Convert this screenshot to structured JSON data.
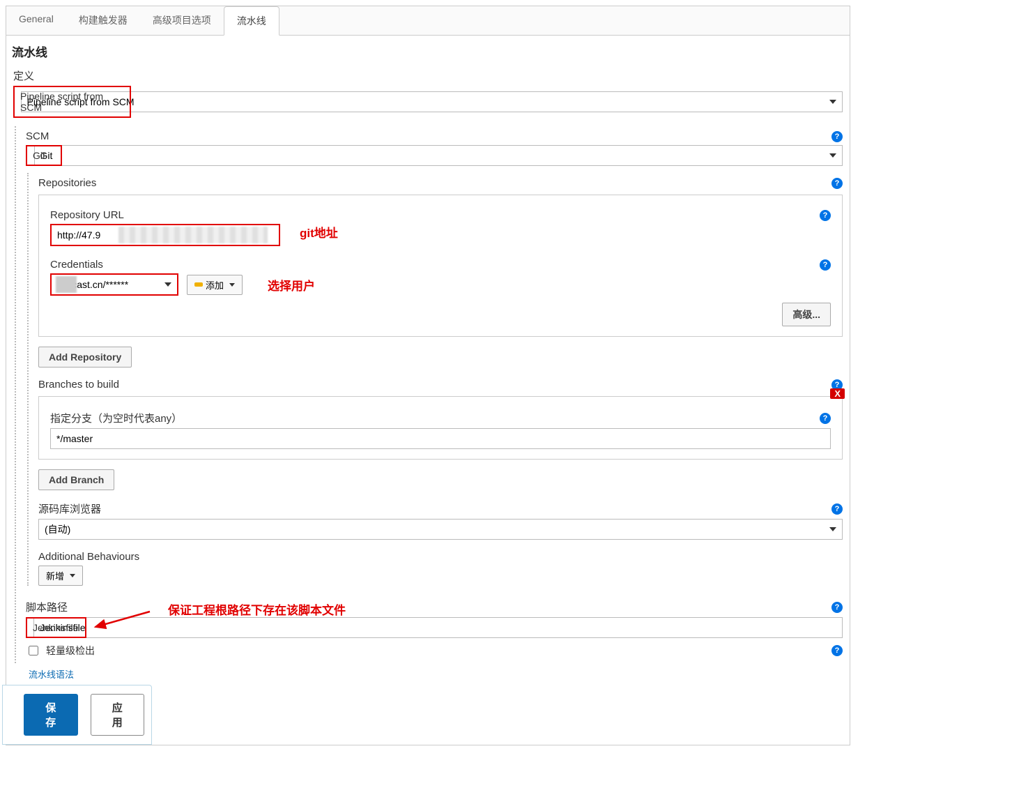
{
  "tabs": {
    "general": "General",
    "triggers": "构建触发器",
    "advanced": "高级项目选项",
    "pipeline": "流水线"
  },
  "sectionTitle": "流水线",
  "labels": {
    "definition": "定义",
    "scm": "SCM",
    "repositories": "Repositories",
    "repoUrl": "Repository URL",
    "credentials": "Credentials",
    "branches": "Branches to build",
    "branchSpec": "指定分支（为空时代表any）",
    "repoBrowser": "源码库浏览器",
    "additionalBehaviours": "Additional Behaviours",
    "scriptPath": "脚本路径",
    "lightweight": "轻量级检出"
  },
  "values": {
    "definition": "Pipeline script from SCM",
    "scm": "Git",
    "repoUrl": "http://47.9                                                          t",
    "credentials": "     @itcast.cn/******",
    "branchSpec": "*/master",
    "repoBrowser": "(自动)",
    "scriptPath": "Jenkinsfile"
  },
  "buttons": {
    "add": "添加",
    "advanced": "高级...",
    "addRepository": "Add Repository",
    "addBranch": "Add Branch",
    "newBehaviour": "新增",
    "save": "保存",
    "apply": "应用"
  },
  "annotations": {
    "gitUrl": "git地址",
    "selectUser": "选择用户",
    "scriptNote": "保证工程根路径下存在该脚本文件"
  },
  "links": {
    "syntax": "流水线语法"
  },
  "deleteLabel": "X"
}
